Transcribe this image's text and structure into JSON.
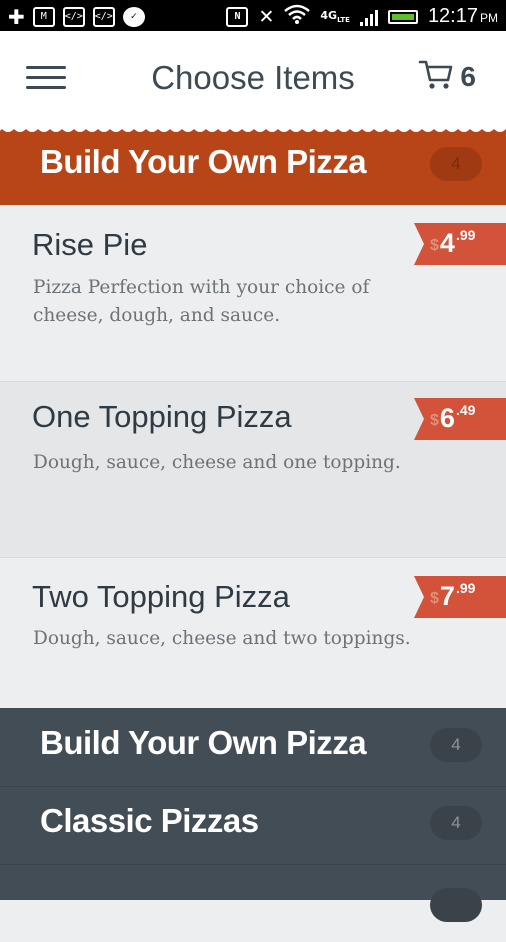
{
  "status_bar": {
    "time": "12:17",
    "ampm": "PM",
    "network": "4G",
    "network_sub": "LTE",
    "battery_color": "#58c12b"
  },
  "header": {
    "title": "Choose Items",
    "cart_count": "6",
    "menu_icon": "hamburger-icon",
    "cart_icon": "cart-icon"
  },
  "section": {
    "title": "Build Your Own Pizza",
    "count": "4",
    "color": "#b84517"
  },
  "items": [
    {
      "name": "Rise Pie",
      "description": "Pizza Perfection with your choice of cheese, dough, and sauce.",
      "currency": "$",
      "dollars": "4",
      "cents": ".99"
    },
    {
      "name": "One Topping Pizza",
      "description": "Dough, sauce, cheese and one topping.",
      "currency": "$",
      "dollars": "6",
      "cents": ".49"
    },
    {
      "name": "Two Topping Pizza",
      "description": "Dough, sauce, cheese and two toppings.",
      "currency": "$",
      "dollars": "7",
      "cents": ".99"
    }
  ],
  "categories": [
    {
      "name": "Build Your Own Pizza",
      "count": "4"
    },
    {
      "name": "Classic Pizzas",
      "count": "4"
    }
  ],
  "colors": {
    "price_tag": "#d2523a",
    "category_bg": "#434d55"
  }
}
